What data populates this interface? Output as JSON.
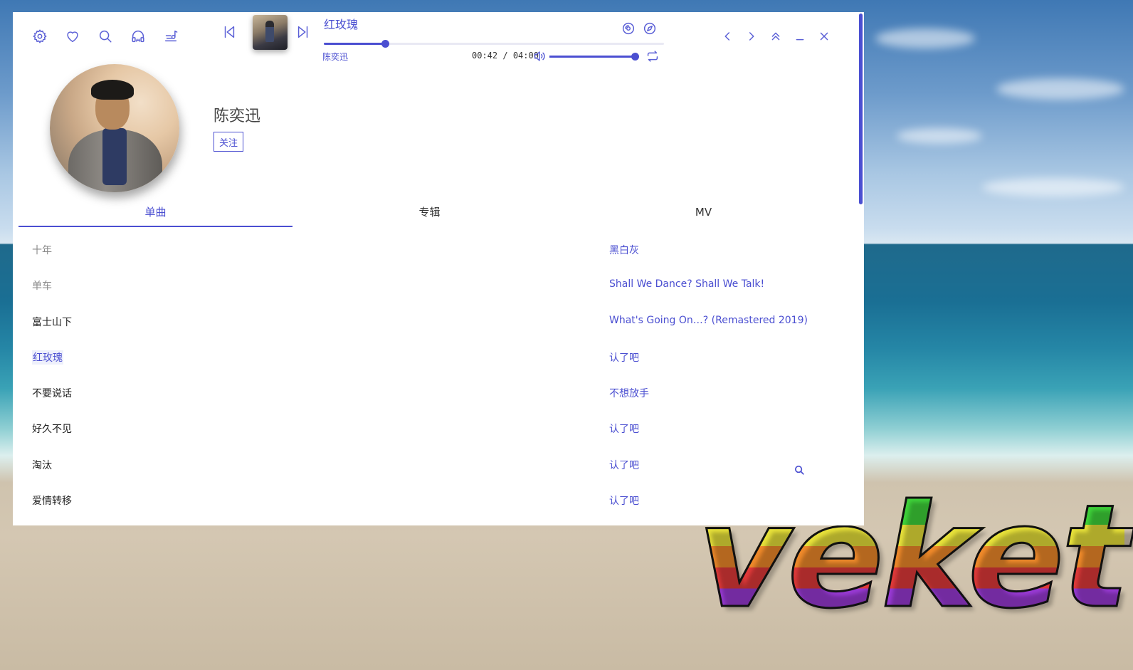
{
  "app": {
    "accent": "#4b4fd1",
    "toolbar_icons": [
      "gear-icon",
      "heart-icon",
      "search-icon",
      "headphones-icon",
      "music-note-icon"
    ],
    "window_controls": [
      "chevron-left-icon",
      "chevron-right-icon",
      "double-chevron-up-icon",
      "minimize-icon",
      "close-icon"
    ]
  },
  "now_playing": {
    "title": "红玫瑰",
    "artist": "陈奕迅",
    "current_time": "00:42",
    "separator": "/",
    "total_time": "04:00",
    "progress": 0.18,
    "volume": 1.0
  },
  "artist": {
    "name": "陈奕迅",
    "follow_label": "关注"
  },
  "tabs": [
    {
      "label": "单曲",
      "active": true
    },
    {
      "label": "专辑",
      "active": false
    },
    {
      "label": "MV",
      "active": false
    }
  ],
  "songs": [
    {
      "name": "十年",
      "album": "黑白灰",
      "state": "muted"
    },
    {
      "name": "单车",
      "album": "Shall We Dance? Shall We Talk!",
      "state": "muted"
    },
    {
      "name": "富士山下",
      "album": "What's Going On…? (Remastered 2019)",
      "state": "normal"
    },
    {
      "name": "红玫瑰",
      "album": "认了吧",
      "state": "playing"
    },
    {
      "name": "不要说话",
      "album": "不想放手",
      "state": "normal"
    },
    {
      "name": "好久不见",
      "album": "认了吧",
      "state": "normal"
    },
    {
      "name": "淘汰",
      "album": "认了吧",
      "state": "normal"
    },
    {
      "name": "爱情转移",
      "album": "认了吧",
      "state": "normal"
    }
  ],
  "watermark": "veket"
}
